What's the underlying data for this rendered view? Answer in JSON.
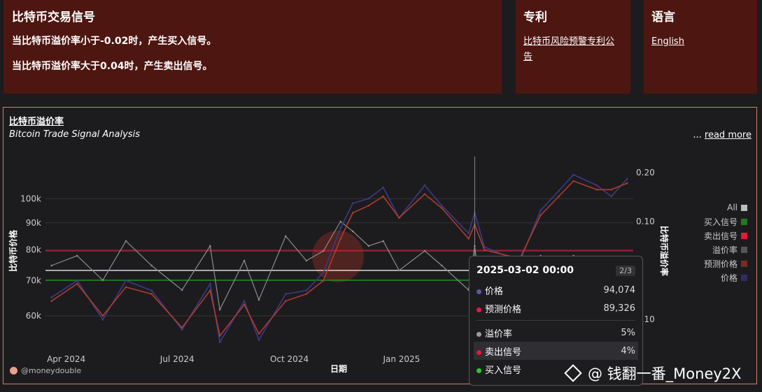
{
  "panel_signal": {
    "title": "比特币交易信号",
    "buy_rule": "当比特币溢价率小于-0.02时，产生买入信号。",
    "sell_rule": "当比特币溢价率大于0.04时，产生卖出信号。"
  },
  "panel_patent": {
    "title": "专利",
    "link": "比特币风险预警专利公告"
  },
  "panel_language": {
    "title": "语言",
    "link": "English"
  },
  "chart_header": {
    "title": "比特币溢价率",
    "subtitle": "Bitcoin Trade Signal Analysis",
    "read_more_prefix": "...",
    "read_more": "read more"
  },
  "legend": [
    {
      "label": "All",
      "color": "#bbbbbb"
    },
    {
      "label": "买入信号",
      "color": "#1f7a1f"
    },
    {
      "label": "卖出信号",
      "color": "#e8173c"
    },
    {
      "label": "溢价率",
      "color": "#555555"
    },
    {
      "label": "预测价格",
      "color": "#7a2a22"
    },
    {
      "label": "价格",
      "color": "#2e2d66"
    }
  ],
  "credit": "@moneydouble",
  "tooltip": {
    "date": "2025-03-02 00:00",
    "page": "2/3",
    "price_label": "价格",
    "price_value": "94,074",
    "pred_label": "预测价格",
    "pred_value": "89,326",
    "premium_label": "溢价率",
    "premium_value": "5%",
    "sell_label": "卖出信号",
    "sell_value": "4%",
    "buy_label": "买入信号",
    "buy_value": ""
  },
  "watermark": "@ 钱翻一番_Money2X",
  "colors": {
    "price": "#3b3a8a",
    "pred": "#b23a2e",
    "premium": "#8c8c8c",
    "sell": "#e8173c",
    "buy": "#1fa51f",
    "white_ref": "#ffffff"
  },
  "chart_data": {
    "type": "line",
    "xlabel": "日期",
    "ylabel_left": "比特币价格",
    "ylabel_right": "比特币溢价率",
    "x_ticks": [
      "Apr 2024",
      "Jul 2024",
      "Oct 2024",
      "Jan 2025"
    ],
    "y_left_ticks": [
      "100k",
      "90k",
      "80k",
      "70k",
      "60k"
    ],
    "y_left_tick_values": [
      100000,
      90000,
      80000,
      70000,
      60000
    ],
    "y_left_scale": "log",
    "y_left_range": [
      52000,
      122000
    ],
    "y_right_ticks": [
      "0.20",
      "0.10",
      "0.10"
    ],
    "y_right_tick_values": [
      0.2,
      0.1,
      -0.1
    ],
    "y_right_range": [
      -0.16,
      0.24
    ],
    "sell_threshold": 0.04,
    "buy_threshold": -0.02,
    "white_reference": 0.0,
    "x_range": [
      "2024-03-15",
      "2025-07-10"
    ],
    "hover_date": "2025-03-02",
    "series": [
      {
        "name": "价格",
        "x": [
          "2024-03-20",
          "2024-04-10",
          "2024-05-01",
          "2024-05-20",
          "2024-06-10",
          "2024-07-05",
          "2024-07-28",
          "2024-08-05",
          "2024-08-25",
          "2024-09-06",
          "2024-09-28",
          "2024-10-15",
          "2024-10-29",
          "2024-11-12",
          "2024-11-22",
          "2024-12-05",
          "2024-12-17",
          "2024-12-30",
          "2025-01-20",
          "2025-02-03",
          "2025-02-25",
          "2025-03-02",
          "2025-03-10",
          "2025-04-08",
          "2025-04-25",
          "2025-05-10",
          "2025-05-22",
          "2025-06-10",
          "2025-06-22",
          "2025-07-05"
        ],
        "values": [
          65000,
          70000,
          59000,
          70000,
          67000,
          56500,
          69000,
          53500,
          64000,
          54000,
          66000,
          67000,
          72500,
          88000,
          98000,
          100000,
          105000,
          92000,
          106000,
          97000,
          86000,
          94074,
          81000,
          76000,
          95000,
          103500,
          111000,
          106000,
          101000,
          109000
        ]
      },
      {
        "name": "预测价格",
        "x": [
          "2024-03-20",
          "2024-04-10",
          "2024-05-01",
          "2024-05-20",
          "2024-06-10",
          "2024-07-05",
          "2024-07-28",
          "2024-08-05",
          "2024-08-25",
          "2024-09-06",
          "2024-09-28",
          "2024-10-15",
          "2024-10-29",
          "2024-11-12",
          "2024-11-22",
          "2024-12-05",
          "2024-12-17",
          "2024-12-30",
          "2025-01-20",
          "2025-02-03",
          "2025-02-25",
          "2025-03-02",
          "2025-03-10",
          "2025-04-08",
          "2025-04-25",
          "2025-05-10",
          "2025-05-22",
          "2025-06-10",
          "2025-06-22",
          "2025-07-05"
        ],
        "values": [
          64000,
          69000,
          60000,
          68000,
          66000,
          57000,
          67000,
          55000,
          63000,
          55500,
          64000,
          66000,
          70000,
          84000,
          94000,
          97000,
          101000,
          92000,
          102000,
          96000,
          84000,
          89326,
          80000,
          77000,
          93000,
          101000,
          108000,
          104000,
          104000,
          107000
        ]
      },
      {
        "name": "溢价率",
        "x": [
          "2024-03-20",
          "2024-04-10",
          "2024-05-01",
          "2024-05-20",
          "2024-06-10",
          "2024-07-05",
          "2024-07-28",
          "2024-08-05",
          "2024-08-25",
          "2024-09-06",
          "2024-09-28",
          "2024-10-15",
          "2024-10-29",
          "2024-11-12",
          "2024-11-22",
          "2024-12-05",
          "2024-12-17",
          "2024-12-30",
          "2025-01-20",
          "2025-02-03",
          "2025-02-25",
          "2025-03-02",
          "2025-03-10",
          "2025-04-08",
          "2025-04-25",
          "2025-05-10",
          "2025-05-22",
          "2025-06-10",
          "2025-06-22",
          "2025-07-05"
        ],
        "values": [
          0.01,
          0.03,
          -0.02,
          0.06,
          0.01,
          -0.04,
          0.05,
          -0.08,
          0.02,
          -0.06,
          0.07,
          0.02,
          0.04,
          0.1,
          0.08,
          0.05,
          0.06,
          0.0,
          0.04,
          0.01,
          -0.04,
          0.05,
          -0.11,
          -0.02,
          0.03,
          0.02,
          0.03,
          0.01,
          -0.02,
          0.02
        ]
      }
    ]
  }
}
